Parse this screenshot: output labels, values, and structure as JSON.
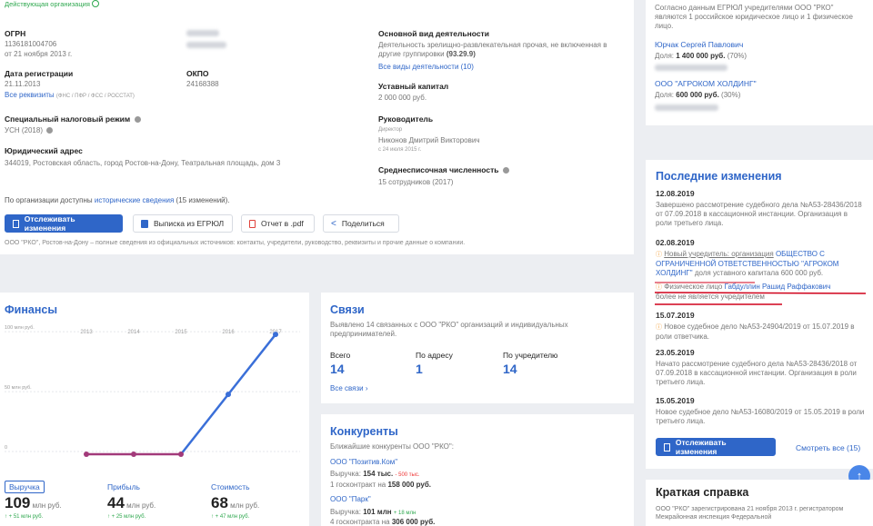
{
  "main": {
    "status": "Действующая организация",
    "ogrn_label": "ОГРН",
    "ogrn_value": "1136181004706",
    "ogrn_date": "от 21 ноября 2013 г.",
    "reg_label": "Дата регистрации",
    "reg_value": "21.11.2013",
    "okpo_label": "ОКПО",
    "okpo_value": "24168388",
    "all_req": "Все реквизиты",
    "all_req_sub": "(ФНС / ПФР / ФСС / РОССТАТ)",
    "tax_label": "Специальный налоговый режим",
    "tax_value": "УСН (2018)",
    "address_label": "Юридический адрес",
    "address_value": "344019, Ростовская область, город Ростов-на-Дону, Театральная площадь, дом 3",
    "activity_label": "Основной вид деятельности",
    "activity_value": "Деятельность зрелищно-развлекательная прочая, не включенная в другие группировки",
    "activity_code": "(93.29.9)",
    "activity_all": "Все виды деятельности (10)",
    "capital_label": "Уставный капитал",
    "capital_value": "2 000 000 руб.",
    "head_label": "Руководитель",
    "head_role": "Директор",
    "head_name": "Никонов Дмитрий Викторович",
    "head_date": "с 24 июля 2015 г.",
    "staff_label": "Среднесписочная численность",
    "staff_value": "15 сотрудников (2017)",
    "history_pre": "По организации доступны",
    "history_link": "исторические сведения",
    "history_post": "(15 изменений).",
    "btn_track": "Отслеживать изменения",
    "btn_egrul": "Выписка из ЕГРЮЛ",
    "btn_pdf": "Отчет в .pdf",
    "btn_share": "Поделиться",
    "footer": "ООО \"РКО\", Ростов-на-Дону – полные сведения из официальных источников: контакты, учредители, руководство, реквизиты и прочие данные о компании."
  },
  "founders": {
    "intro": "Согласно данным ЕГРЮЛ учредителями ООО \"РКО\" являются 1 российское юридическое лицо и 1 физическое лицо.",
    "person_name": "Юрчак Сергей Павлович",
    "person_share_pre": "Доля:",
    "person_share": "1 400 000 руб.",
    "person_pct": "(70%)",
    "org_name": "ООО \"АГРОКОМ ХОЛДИНГ\"",
    "org_share_pre": "Доля:",
    "org_share": "600 000 руб.",
    "org_pct": "(30%)"
  },
  "changes": {
    "title": "Последние изменения",
    "d1": "12.08.2019",
    "t1": "Завершено рассмотрение судебного дела №А53-28436/2018 от 07.09.2018 в кассационной инстанции. Организация в роли третьего лица.",
    "d2": "02.08.2019",
    "t2a": "Новый учредитель: организация",
    "t2b": "ОБЩЕСТВО С ОГРАНИЧЕННОЙ ОТВЕТСТВЕННОСТЬЮ \"АГРОКОМ ХОЛДИНГ\"",
    "t2c": "доля уставного капитала 600 000 руб.",
    "t2d": "Физическое лицо",
    "t2e": "Габдуллин Рашид Раффакович",
    "t2f": "более не является учредителем",
    "d3": "15.07.2019",
    "t3": "Новое судебное дело №А53-24904/2019 от 15.07.2019 в роли ответчика.",
    "d4": "23.05.2019",
    "t4": "Начато рассмотрение судебного дела №А53-28436/2018 от 07.09.2018 в кассационной инстанции. Организация в роли третьего лица.",
    "d5": "15.05.2019",
    "t5": "Новое судебное дело №А53-16080/2019 от 15.05.2019 в роли третьего лица.",
    "btn_track": "Отслеживать изменения",
    "see_all": "Смотреть все (15)"
  },
  "summary": {
    "title": "Краткая справка",
    "text": "ООО \"РКО\" зарегистрирована 21 ноября 2013 г. регистратором Межрайонная инспекция Федеральной"
  },
  "finance": {
    "title": "Финансы",
    "tab1": "Выручка",
    "tab2": "Прибыль",
    "tab3": "Стоимость",
    "v1": "109",
    "u1": "млн руб.",
    "c1": "↑ + 51 млн руб.",
    "v2": "44",
    "u2": "млн руб.",
    "c2": "↑ + 25 млн руб.",
    "v3": "68",
    "u3": "млн руб.",
    "c3": "↑ + 47 млн руб."
  },
  "chart_data": {
    "type": "line",
    "categories": [
      "2013",
      "2014",
      "2015",
      "2016",
      "2017"
    ],
    "series": [
      {
        "values": [
          0,
          0,
          0,
          50,
          100
        ]
      }
    ],
    "ytick_labels": [
      "100 млн руб.",
      "50 млн руб.",
      "0"
    ],
    "ylim": [
      0,
      110
    ],
    "grid": true
  },
  "links": {
    "title": "Связи",
    "text": "Выявлено 14 связанных с ООО \"РКО\" организаций и индивидуальных предпринимателей.",
    "all_label": "Всего",
    "all_value": "14",
    "addr_label": "По адресу",
    "addr_value": "1",
    "founder_label": "По учредителю",
    "founder_value": "14",
    "more": "Все связи"
  },
  "competitors": {
    "title": "Конкуренты",
    "intro": "Ближайшие конкуренты ООО \"РКО\":",
    "c1_name": "ООО \"Позитив.Ком\"",
    "c1_rev_pre": "Выручка:",
    "c1_rev": "154 тыс.",
    "c1_delta": "- 500 тыс.",
    "c1_contract_pre": "1 госконтракт на",
    "c1_contract": "158 000 руб.",
    "c2_name": "ООО \"Парк\"",
    "c2_rev_pre": "Выручка:",
    "c2_rev": "101 млн",
    "c2_delta": "+ 18 млн",
    "c2_contract_pre": "4 госконтракта на",
    "c2_contract": "306 000 руб."
  },
  "colors": {
    "accent": "#2f66c8",
    "line": "#3a6fd8",
    "flat": "#a23a7a",
    "annotation": "#d0021b"
  }
}
